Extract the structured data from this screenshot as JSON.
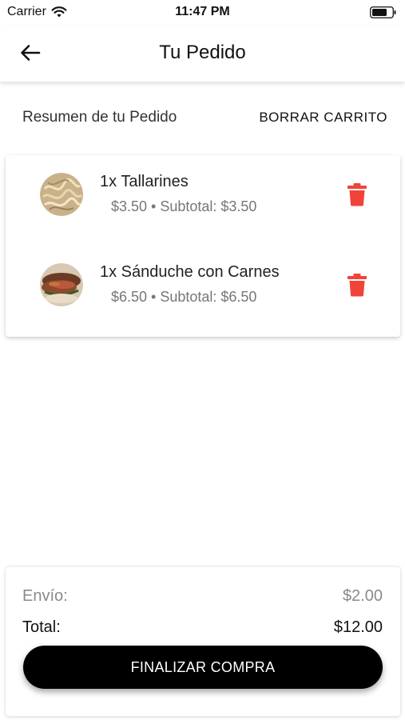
{
  "status_bar": {
    "carrier": "Carrier",
    "time": "11:47 PM",
    "wifi_icon": "wifi-icon",
    "battery_icon": "battery-icon"
  },
  "header": {
    "back_icon": "arrow-left-icon",
    "title": "Tu Pedido"
  },
  "summary": {
    "label": "Resumen de tu Pedido",
    "clear_label": "BORRAR CARRITO"
  },
  "items": [
    {
      "title": "1x Tallarines",
      "subtitle": "$3.50 • Subtotal: $3.50",
      "delete_icon": "trash-icon"
    },
    {
      "title": "1x Sánduche con Carnes",
      "subtitle": "$6.50 • Subtotal: $6.50",
      "delete_icon": "trash-icon"
    }
  ],
  "totals": {
    "shipping_label": "Envío:",
    "shipping_value": "$2.00",
    "total_label": "Total:",
    "total_value": "$12.00"
  },
  "checkout": {
    "label": "FINALIZAR COMPRA"
  },
  "colors": {
    "delete_red": "#f04438",
    "button_black": "#000000"
  }
}
